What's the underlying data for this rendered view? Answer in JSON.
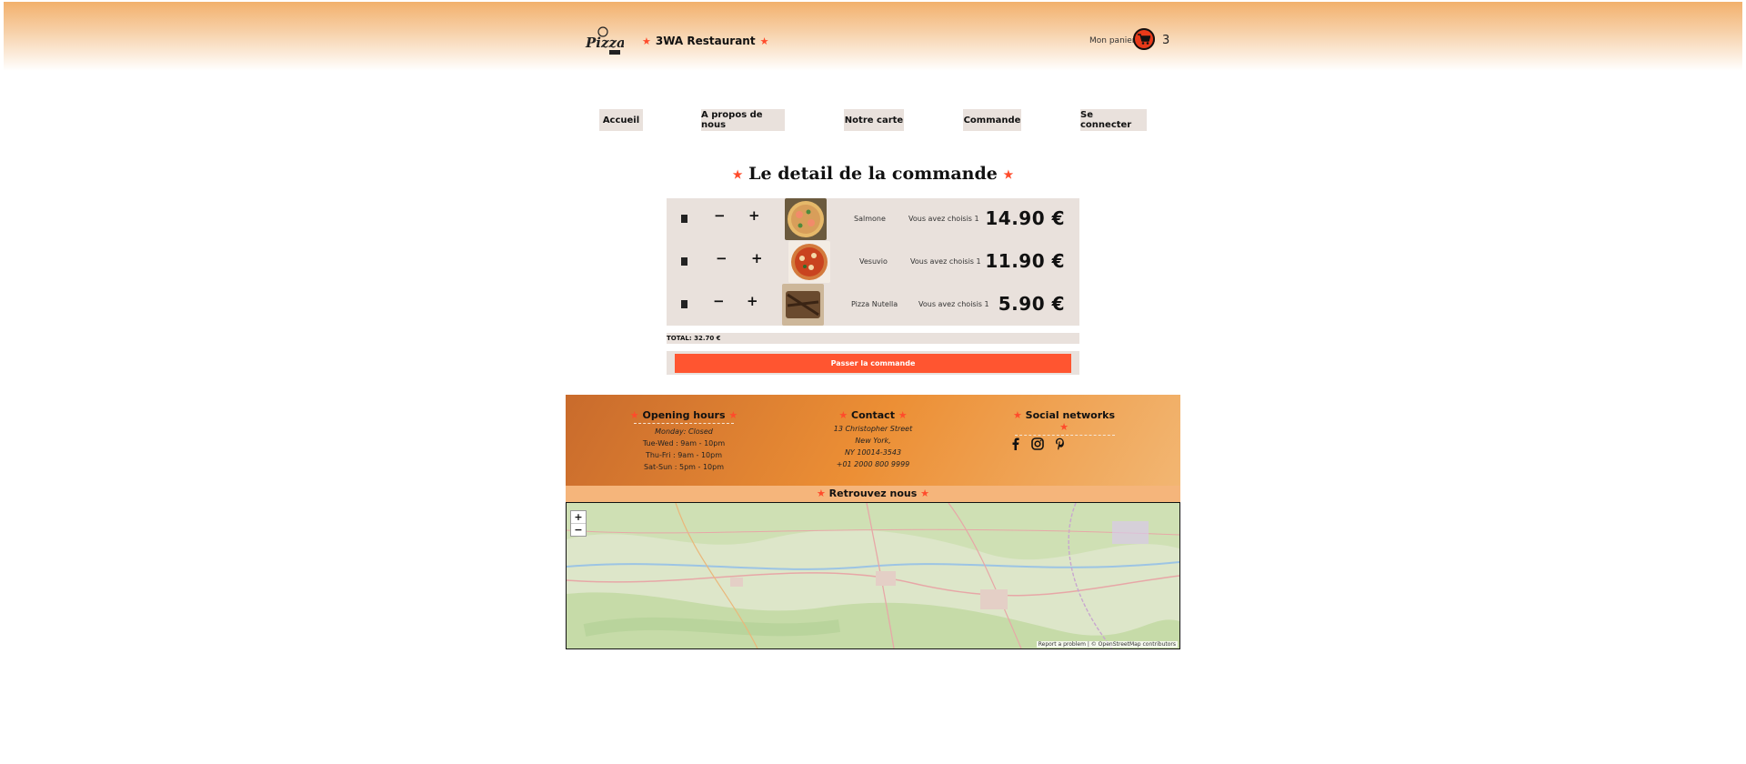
{
  "header": {
    "brand": "3WA Restaurant",
    "cart_label": "Mon panier",
    "cart_count": "3"
  },
  "nav": [
    {
      "label": "Accueil"
    },
    {
      "label": "A propos de nous"
    },
    {
      "label": "Notre carte"
    },
    {
      "label": "Commande"
    },
    {
      "label": "Se connecter"
    }
  ],
  "page_title": "Le detail de la commande",
  "order": {
    "items": [
      {
        "name": "Salmone",
        "chosen": "Vous avez choisis 1",
        "price": "14.90 €"
      },
      {
        "name": "Vesuvio",
        "chosen": "Vous avez choisis 1",
        "price": "11.90 €"
      },
      {
        "name": "Pizza Nutella",
        "chosen": "Vous avez choisis 1",
        "price": "5.90 €"
      }
    ],
    "total": "TOTAL: 32.70 €",
    "submit_label": "Passer la commande"
  },
  "footer": {
    "hours": {
      "title": "Opening hours",
      "lines": [
        "Monday: Closed",
        "Tue-Wed : 9am - 10pm",
        "Thu-Fri : 9am - 10pm",
        "Sat-Sun : 5pm - 10pm"
      ]
    },
    "contact": {
      "title": "Contact",
      "lines": [
        "13 Christopher Street",
        "New York,",
        "NY 10014-3543",
        "+01 2000 800 9999"
      ]
    },
    "social": {
      "title": "Social networks",
      "icons": [
        "facebook-icon",
        "instagram-icon",
        "pinterest-icon"
      ]
    }
  },
  "map": {
    "title": "Retrouvez nous",
    "zoom_in": "+",
    "zoom_out": "−",
    "attribution": "Report a problem | © OpenStreetMap contributors"
  },
  "icons": {
    "minus": "−",
    "plus": "+"
  },
  "colors": {
    "accent": "#ff5530",
    "star": "#ff4b2b",
    "panel": "#e9e1dc"
  }
}
